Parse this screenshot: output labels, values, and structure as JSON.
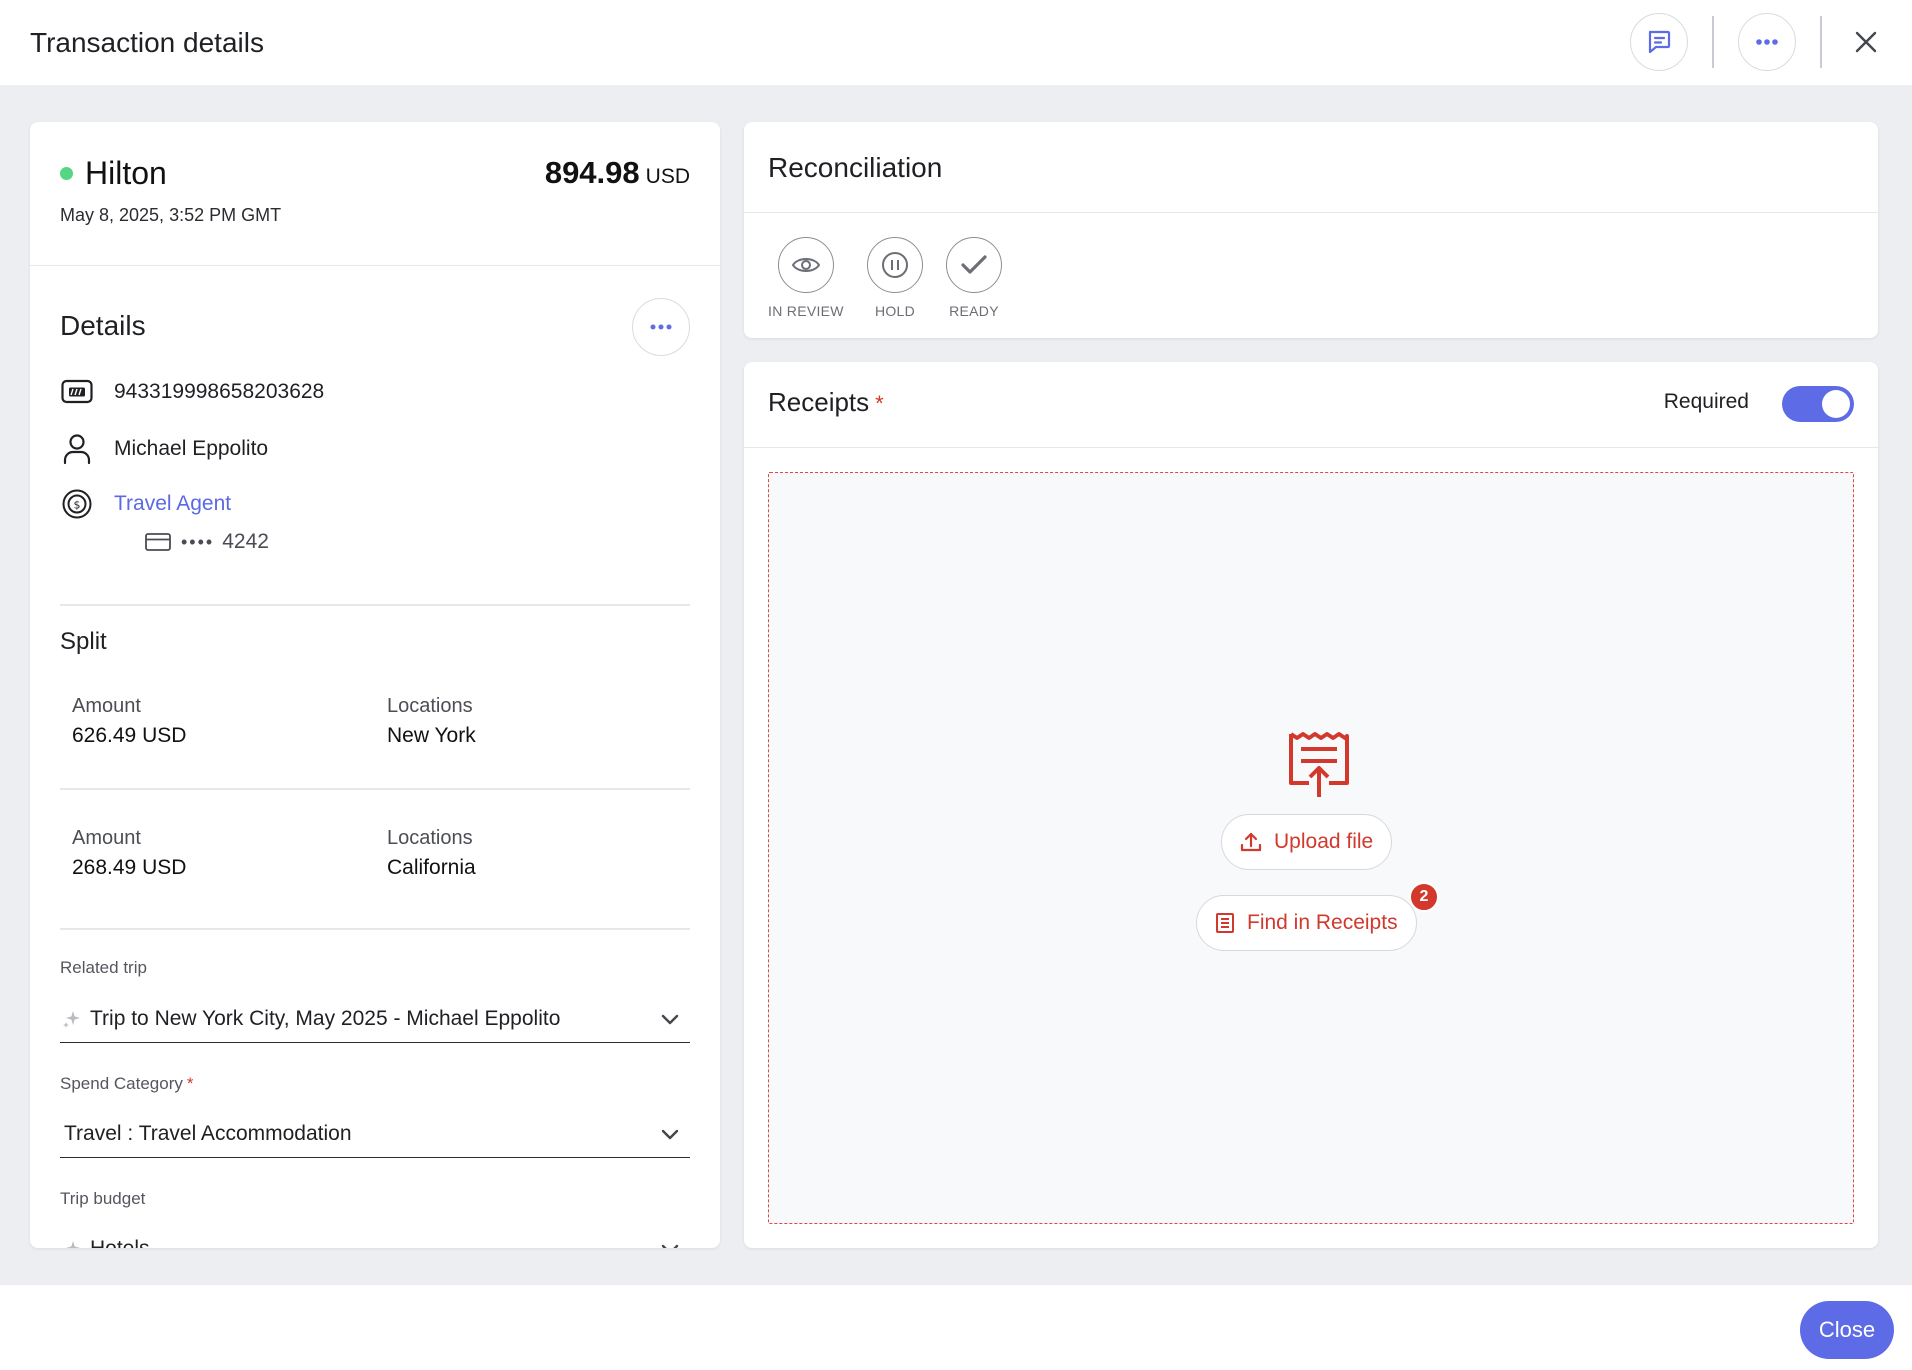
{
  "header": {
    "title": "Transaction details"
  },
  "transaction": {
    "merchant": "Hilton",
    "datetime": "May 8, 2025, 3:52 PM GMT",
    "amount": "894.98",
    "currency": "USD",
    "status_color": "#56d685"
  },
  "details": {
    "heading": "Details",
    "transaction_id": "943319998658203628",
    "cardholder": "Michael Eppolito",
    "card_program": "Travel Agent",
    "card_dots": "••••",
    "card_last4": "4242"
  },
  "split": {
    "heading": "Split",
    "rows": [
      {
        "amount_label": "Amount",
        "amount": "626.49 USD",
        "locations_label": "Locations",
        "location": "New York"
      },
      {
        "amount_label": "Amount",
        "amount": "268.49 USD",
        "locations_label": "Locations",
        "location": "California"
      }
    ]
  },
  "fields": {
    "related_trip_label": "Related trip",
    "related_trip_value": "Trip to New York City, May 2025 - Michael Eppolito",
    "spend_category_label": "Spend Category",
    "spend_category_required": "*",
    "spend_category_value": "Travel : Travel Accommodation",
    "trip_budget_label": "Trip budget",
    "trip_budget_value": "Hotels"
  },
  "reconciliation": {
    "heading": "Reconciliation",
    "statuses": [
      {
        "label": "IN REVIEW",
        "icon": "eye-icon"
      },
      {
        "label": "HOLD",
        "icon": "pause-icon"
      },
      {
        "label": "READY",
        "icon": "check-icon"
      }
    ]
  },
  "receipts": {
    "heading": "Receipts",
    "required_mark": "*",
    "required_label": "Required",
    "required_on": true,
    "upload_label": "Upload file",
    "find_label": "Find in Receipts",
    "find_badge": "2",
    "accent_color": "#d2392c"
  },
  "footer": {
    "close_label": "Close"
  },
  "colors": {
    "primary": "#5e6be6",
    "link": "#5b69e3",
    "danger": "#d2392c",
    "background": "#eceef2"
  }
}
